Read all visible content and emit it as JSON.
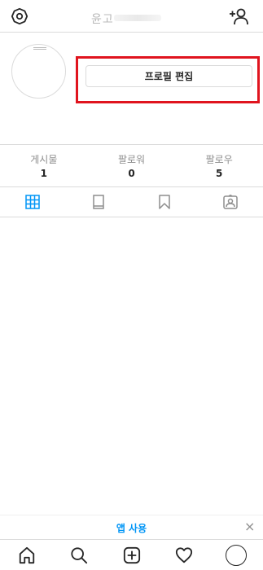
{
  "header": {
    "username": "윤고",
    "settings_icon": "gear-icon",
    "add_user_icon": "add-user-icon"
  },
  "profile": {
    "edit_profile_label": "프로필 편집",
    "highlight_color": "#e0141e"
  },
  "stats": [
    {
      "label": "게시물",
      "count": "1"
    },
    {
      "label": "팔로워",
      "count": "0"
    },
    {
      "label": "팔로우",
      "count": "5"
    }
  ],
  "tabs": [
    {
      "name": "grid",
      "icon": "grid-icon",
      "active": true
    },
    {
      "name": "igtv",
      "icon": "tv-icon",
      "active": false
    },
    {
      "name": "saved",
      "icon": "bookmark-icon",
      "active": false
    },
    {
      "name": "tagged",
      "icon": "tagged-icon",
      "active": false
    }
  ],
  "banner": {
    "app_use_label": "앱 사용",
    "close_label": "×",
    "accent_color": "#0095f6"
  },
  "bottom_nav": [
    {
      "name": "home",
      "icon": "home-icon"
    },
    {
      "name": "search",
      "icon": "search-icon"
    },
    {
      "name": "new-post",
      "icon": "plus-square-icon"
    },
    {
      "name": "activity",
      "icon": "heart-icon"
    },
    {
      "name": "profile",
      "icon": "avatar"
    }
  ]
}
